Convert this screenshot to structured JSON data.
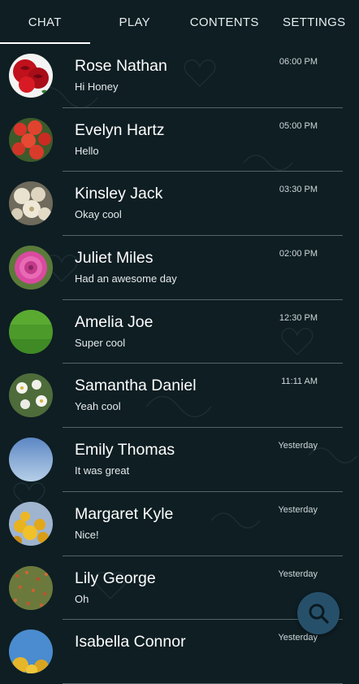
{
  "tabs": [
    {
      "label": "CHAT",
      "active": true
    },
    {
      "label": "PLAY",
      "active": false
    },
    {
      "label": "CONTENTS",
      "active": false
    },
    {
      "label": "SETTINGS",
      "active": false
    }
  ],
  "chats": [
    {
      "name": "Rose Nathan",
      "message": "Hi Honey",
      "time": "06:00 PM"
    },
    {
      "name": "Evelyn Hartz",
      "message": "Hello",
      "time": "05:00 PM"
    },
    {
      "name": "Kinsley Jack",
      "message": "Okay cool",
      "time": "03:30 PM"
    },
    {
      "name": "Juliet Miles",
      "message": "Had an awesome day",
      "time": "02:00 PM"
    },
    {
      "name": "Amelia Joe",
      "message": "Super cool",
      "time": "12:30 PM"
    },
    {
      "name": "Samantha Daniel",
      "message": "Yeah cool",
      "time": "11:11 AM"
    },
    {
      "name": "Emily Thomas",
      "message": "It was great",
      "time": "Yesterday"
    },
    {
      "name": "Margaret Kyle",
      "message": "Nice!",
      "time": "Yesterday"
    },
    {
      "name": "Lily George",
      "message": "Oh",
      "time": "Yesterday"
    },
    {
      "name": "Isabella Connor",
      "message": "",
      "time": "Yesterday"
    }
  ],
  "fab": {
    "icon": "search-icon"
  },
  "colors": {
    "background": "#0e1e23",
    "fab": "#26506a",
    "divider": "#54646a"
  }
}
